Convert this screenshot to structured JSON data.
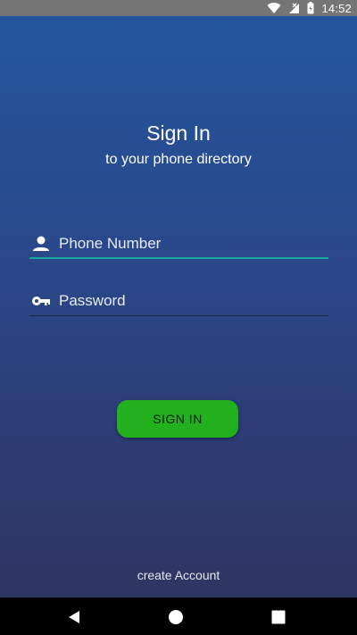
{
  "status_bar": {
    "time": "14:52",
    "icons": [
      "wifi-icon",
      "signal-icon",
      "battery-icon"
    ]
  },
  "header": {
    "title": "Sign In",
    "subtitle": "to your phone directory"
  },
  "form": {
    "phone": {
      "placeholder": "Phone Number",
      "value": "",
      "icon": "person-icon"
    },
    "password": {
      "placeholder": "Password",
      "value": "",
      "icon": "key-icon"
    },
    "signin_label": "SIGN IN"
  },
  "footer": {
    "create_account_label": "create Account"
  },
  "nav_bar": {
    "buttons": [
      "back-icon",
      "home-icon",
      "recents-icon"
    ]
  },
  "colors": {
    "background_top": "#23579f",
    "background_bottom": "#2e3561",
    "accent_underline": "#17a69a",
    "button": "#22b01f"
  }
}
